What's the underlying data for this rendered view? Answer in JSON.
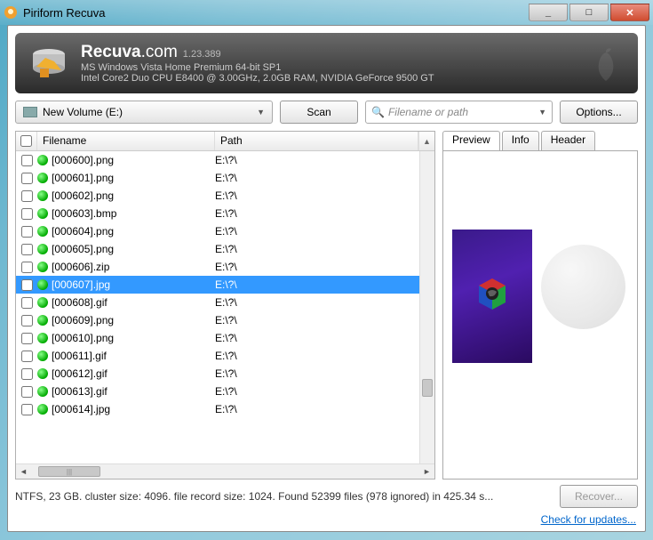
{
  "window": {
    "title": "Piriform Recuva",
    "min": "_",
    "max": "□",
    "close": "✕"
  },
  "banner": {
    "brand_bold": "Recuva",
    "brand_rest": ".com",
    "version": "1.23.389",
    "line1": "MS Windows Vista Home Premium 64-bit SP1",
    "line2": "Intel Core2 Duo CPU E8400 @ 3.00GHz, 2.0GB RAM, NVIDIA GeForce 9500 GT"
  },
  "toolbar": {
    "drive": "New Volume (E:)",
    "scan": "Scan",
    "search_placeholder": "Filename or path",
    "options": "Options..."
  },
  "columns": {
    "filename": "Filename",
    "path": "Path"
  },
  "files": [
    {
      "name": "[000600].png",
      "path": "E:\\?\\",
      "selected": false
    },
    {
      "name": "[000601].png",
      "path": "E:\\?\\",
      "selected": false
    },
    {
      "name": "[000602].png",
      "path": "E:\\?\\",
      "selected": false
    },
    {
      "name": "[000603].bmp",
      "path": "E:\\?\\",
      "selected": false
    },
    {
      "name": "[000604].png",
      "path": "E:\\?\\",
      "selected": false
    },
    {
      "name": "[000605].png",
      "path": "E:\\?\\",
      "selected": false
    },
    {
      "name": "[000606].zip",
      "path": "E:\\?\\",
      "selected": false
    },
    {
      "name": "[000607].jpg",
      "path": "E:\\?\\",
      "selected": true
    },
    {
      "name": "[000608].gif",
      "path": "E:\\?\\",
      "selected": false
    },
    {
      "name": "[000609].png",
      "path": "E:\\?\\",
      "selected": false
    },
    {
      "name": "[000610].png",
      "path": "E:\\?\\",
      "selected": false
    },
    {
      "name": "[000611].gif",
      "path": "E:\\?\\",
      "selected": false
    },
    {
      "name": "[000612].gif",
      "path": "E:\\?\\",
      "selected": false
    },
    {
      "name": "[000613].gif",
      "path": "E:\\?\\",
      "selected": false
    },
    {
      "name": "[000614].jpg",
      "path": "E:\\?\\",
      "selected": false
    }
  ],
  "preview": {
    "tabs": {
      "preview": "Preview",
      "info": "Info",
      "header": "Header"
    }
  },
  "status": "NTFS, 23 GB. cluster size: 4096. file record size: 1024. Found 52399 files (978 ignored) in 425.34 s...",
  "recover": "Recover...",
  "updates": "Check for updates..."
}
